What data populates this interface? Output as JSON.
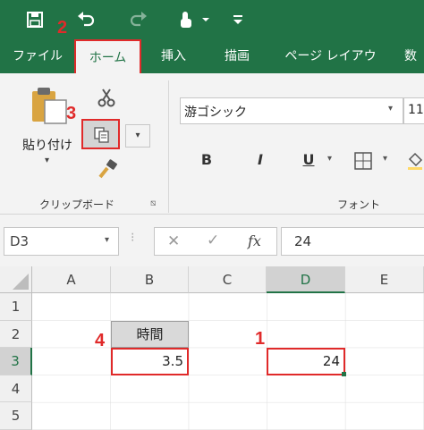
{
  "qat": {
    "save_icon": "save-icon",
    "undo_icon": "undo-icon",
    "redo_icon": "redo-icon",
    "touch_icon": "touch-mode-icon",
    "customize_icon": "customize-qat-icon"
  },
  "tabs": [
    {
      "label": "ファイル"
    },
    {
      "label": "ホーム"
    },
    {
      "label": "挿入"
    },
    {
      "label": "描画"
    },
    {
      "label": "ページ レイアウト"
    },
    {
      "label": "数"
    }
  ],
  "ribbon": {
    "paste_label": "貼り付け",
    "clipboard_group": "クリップボード",
    "font_group": "フォント",
    "font_name": "游ゴシック",
    "font_size": "11",
    "bold": "B",
    "italic": "I",
    "underline": "U"
  },
  "formula_bar": {
    "name_box": "D3",
    "cancel": "✕",
    "enter": "✓",
    "fx": "fx",
    "value": "24"
  },
  "grid": {
    "columns": [
      "A",
      "B",
      "C",
      "D",
      "E"
    ],
    "rows": [
      "1",
      "2",
      "3",
      "4",
      "5"
    ],
    "b2": "時間",
    "b3": "3.5",
    "d3": "24"
  },
  "markers": {
    "m1": "1",
    "m2": "2",
    "m3": "3",
    "m4": "4"
  },
  "colors": {
    "excel_green": "#217346",
    "highlight_red": "#e02a2a"
  }
}
